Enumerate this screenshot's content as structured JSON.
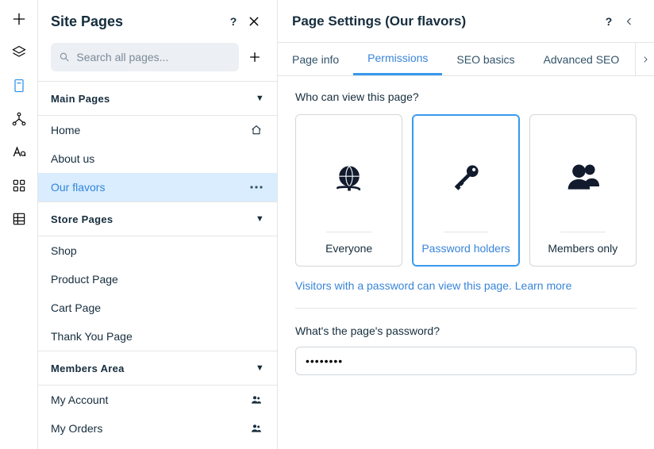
{
  "iconbar": {
    "items": [
      "plus-icon",
      "layers-icon",
      "page-icon",
      "hierarchy-icon",
      "text-style-icon",
      "apps-icon",
      "data-icon"
    ]
  },
  "sidepanel": {
    "title": "Site Pages",
    "search_placeholder": "Search all pages...",
    "sections": [
      {
        "title": "Main Pages",
        "items": [
          {
            "label": "Home",
            "icon": "home-icon"
          },
          {
            "label": "About us"
          },
          {
            "label": "Our flavors",
            "selected": true,
            "trailing": "more-icon"
          }
        ]
      },
      {
        "title": "Store Pages",
        "items": [
          {
            "label": "Shop"
          },
          {
            "label": "Product Page"
          },
          {
            "label": "Cart Page"
          },
          {
            "label": "Thank You Page"
          }
        ]
      },
      {
        "title": "Members Area",
        "items": [
          {
            "label": "My Account",
            "icon": "members-icon"
          },
          {
            "label": "My Orders",
            "icon": "members-icon"
          }
        ]
      }
    ]
  },
  "settings": {
    "title": "Page Settings (Our flavors)",
    "tabs": [
      "Page info",
      "Permissions",
      "SEO basics",
      "Advanced SEO"
    ],
    "active_tab": 1,
    "question": "Who can view this page?",
    "options": [
      {
        "caption": "Everyone",
        "icon": "globe-icon"
      },
      {
        "caption": "Password holders",
        "icon": "key-icon",
        "selected": true
      },
      {
        "caption": "Members only",
        "icon": "members-large-icon"
      }
    ],
    "note_lead": "Visitors with a password can view this page. ",
    "note_link": "Learn more",
    "password_label": "What's the page's password?",
    "password_value": "••••••••"
  }
}
